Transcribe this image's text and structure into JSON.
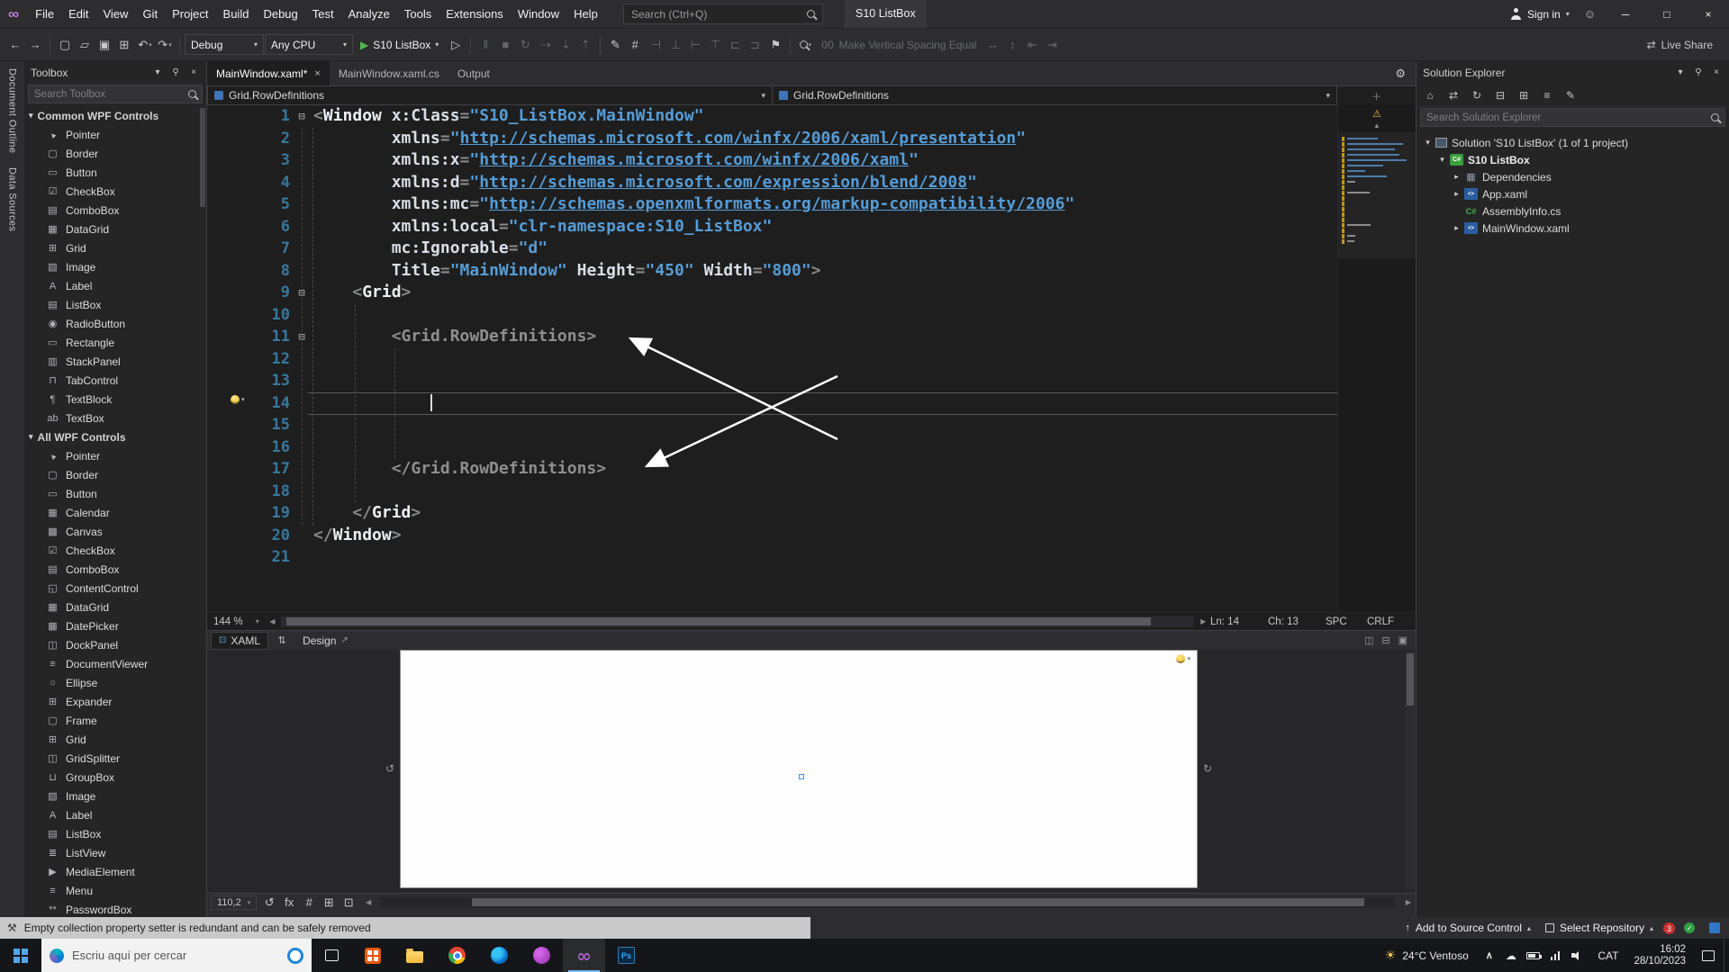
{
  "titlebar": {
    "menus": [
      "File",
      "Edit",
      "View",
      "Git",
      "Project",
      "Build",
      "Debug",
      "Test",
      "Analyze",
      "Tools",
      "Extensions",
      "Window",
      "Help"
    ],
    "search_placeholder": "Search (Ctrl+Q)",
    "window_title": "S10 ListBox",
    "sign_in": "Sign in"
  },
  "toolbar": {
    "nav_icons": [
      "back",
      "forward"
    ],
    "file_icons": [
      "new-project",
      "open-file",
      "save",
      "save-all"
    ],
    "edit_icons": [
      "undo",
      "redo"
    ],
    "debug_config": "Debug",
    "platform": "Any CPU",
    "run_label": "S10 ListBox",
    "run_icons": [
      "start-without-debugging"
    ],
    "debug_icons": [
      "break-all",
      "stop-debugging",
      "restart"
    ],
    "step_icons": [
      "show-next-statement",
      "step-into",
      "step-over"
    ],
    "design_icons": [
      "edit-style",
      "show-grid"
    ],
    "align_icons": [
      "align-lefts",
      "align-centers",
      "align-rights",
      "align-tops",
      "align-middles",
      "align-bottoms"
    ],
    "bookmark_icons": [
      "bookmark"
    ],
    "spacing_prefix": "00",
    "spacing_label": "Make Vertical Spacing Equal",
    "spacing_icons": [
      "decrease-h-spacing",
      "increase-h-spacing",
      "decrease-v-spacing",
      "increase-v-spacing"
    ],
    "live_share": "Live Share"
  },
  "left_strip": {
    "tabs": [
      "Document Outline",
      "Data Sources"
    ]
  },
  "toolbox": {
    "title": "Toolbox",
    "search_placeholder": "Search Toolbox",
    "sections": [
      {
        "label": "Common WPF Controls",
        "items": [
          "Pointer",
          "Border",
          "Button",
          "CheckBox",
          "ComboBox",
          "DataGrid",
          "Grid",
          "Image",
          "Label",
          "ListBox",
          "RadioButton",
          "Rectangle",
          "StackPanel",
          "TabControl",
          "TextBlock",
          "TextBox"
        ]
      },
      {
        "label": "All WPF Controls",
        "items": [
          "Pointer",
          "Border",
          "Button",
          "Calendar",
          "Canvas",
          "CheckBox",
          "ComboBox",
          "ContentControl",
          "DataGrid",
          "DatePicker",
          "DockPanel",
          "DocumentViewer",
          "Ellipse",
          "Expander",
          "Frame",
          "Grid",
          "GridSplitter",
          "GroupBox",
          "Image",
          "Label",
          "ListBox",
          "ListView",
          "MediaElement",
          "Menu",
          "PasswordBox"
        ]
      }
    ]
  },
  "editor": {
    "tabs": [
      {
        "label": "MainWindow.xaml*",
        "active": true
      },
      {
        "label": "MainWindow.xaml.cs",
        "active": false
      },
      {
        "label": "Output",
        "active": false
      }
    ],
    "breadcrumb_left": "Grid.RowDefinitions",
    "breadcrumb_right": "Grid.RowDefinitions",
    "zoom": "144 %",
    "status": {
      "line": "Ln: 14",
      "column": "Ch: 13",
      "spaces": "SPC",
      "line_ending": "CRLF"
    },
    "code": {
      "cursor": {
        "line": 14,
        "col": 12
      },
      "lines": [
        {
          "n": 1,
          "ind": 0,
          "fold": true,
          "seg": [
            [
              "p",
              "<"
            ],
            [
              "t",
              "Window"
            ],
            [
              "s",
              " "
            ],
            [
              "a",
              "x:Class"
            ],
            [
              "o",
              "="
            ],
            [
              "v",
              "\"S10_ListBox.MainWindow\""
            ]
          ]
        },
        {
          "n": 2,
          "ind": 8,
          "seg": [
            [
              "a",
              "xmlns"
            ],
            [
              "o",
              "="
            ],
            [
              "v",
              "\""
            ],
            [
              "u",
              "http://schemas.microsoft.com/winfx/2006/xaml/presentation"
            ],
            [
              "v",
              "\""
            ]
          ]
        },
        {
          "n": 3,
          "ind": 8,
          "seg": [
            [
              "a",
              "xmlns:x"
            ],
            [
              "o",
              "="
            ],
            [
              "v",
              "\""
            ],
            [
              "u",
              "http://schemas.microsoft.com/winfx/2006/xaml"
            ],
            [
              "v",
              "\""
            ]
          ]
        },
        {
          "n": 4,
          "ind": 8,
          "seg": [
            [
              "a",
              "xmlns:d"
            ],
            [
              "o",
              "="
            ],
            [
              "v",
              "\""
            ],
            [
              "u",
              "http://schemas.microsoft.com/expression/blend/2008"
            ],
            [
              "v",
              "\""
            ]
          ]
        },
        {
          "n": 5,
          "ind": 8,
          "seg": [
            [
              "a",
              "xmlns:mc"
            ],
            [
              "o",
              "="
            ],
            [
              "v",
              "\""
            ],
            [
              "u",
              "http://schemas.openxmlformats.org/markup-compatibility/2006"
            ],
            [
              "v",
              "\""
            ]
          ]
        },
        {
          "n": 6,
          "ind": 8,
          "seg": [
            [
              "a",
              "xmlns:local"
            ],
            [
              "o",
              "="
            ],
            [
              "v",
              "\"clr-namespace:S10_ListBox\""
            ]
          ]
        },
        {
          "n": 7,
          "ind": 8,
          "seg": [
            [
              "a",
              "mc:Ignorable"
            ],
            [
              "o",
              "="
            ],
            [
              "v",
              "\"d\""
            ]
          ]
        },
        {
          "n": 8,
          "ind": 8,
          "seg": [
            [
              "a",
              "Title"
            ],
            [
              "o",
              "="
            ],
            [
              "v",
              "\"MainWindow\""
            ],
            [
              "s",
              " "
            ],
            [
              "a",
              "Height"
            ],
            [
              "o",
              "="
            ],
            [
              "v",
              "\"450\""
            ],
            [
              "s",
              " "
            ],
            [
              "a",
              "Width"
            ],
            [
              "o",
              "="
            ],
            [
              "v",
              "\"800\""
            ],
            [
              "p",
              ">"
            ]
          ]
        },
        {
          "n": 9,
          "ind": 4,
          "fold": true,
          "seg": [
            [
              "p",
              "<"
            ],
            [
              "t",
              "Grid"
            ],
            [
              "p",
              ">"
            ]
          ]
        },
        {
          "n": 10,
          "ind": 0,
          "seg": []
        },
        {
          "n": 11,
          "ind": 8,
          "fold": true,
          "seg": [
            [
              "g",
              "<Grid.RowDefinitions>"
            ]
          ]
        },
        {
          "n": 12,
          "ind": 0,
          "seg": []
        },
        {
          "n": 13,
          "ind": 0,
          "seg": []
        },
        {
          "n": 14,
          "ind": 0,
          "seg": []
        },
        {
          "n": 15,
          "ind": 0,
          "seg": []
        },
        {
          "n": 16,
          "ind": 0,
          "seg": []
        },
        {
          "n": 17,
          "ind": 8,
          "seg": [
            [
              "g",
              "</Grid.RowDefinitions>"
            ]
          ]
        },
        {
          "n": 18,
          "ind": 0,
          "seg": []
        },
        {
          "n": 19,
          "ind": 4,
          "seg": [
            [
              "p",
              "</"
            ],
            [
              "t",
              "Grid"
            ],
            [
              "p",
              ">"
            ]
          ]
        },
        {
          "n": 20,
          "ind": 0,
          "seg": [
            [
              "p",
              "</"
            ],
            [
              "t",
              "Window"
            ],
            [
              "p",
              ">"
            ]
          ]
        },
        {
          "n": 21,
          "ind": 0,
          "seg": []
        }
      ]
    }
  },
  "designer": {
    "xaml_tab": "XAML",
    "design_tab": "Design",
    "zoom": "110,2",
    "toolbar_icons": [
      "zoom-fit",
      "effects",
      "show-grid",
      "snap-to-grid",
      "snap-to-guides"
    ]
  },
  "solution_explorer": {
    "title": "Solution Explorer",
    "search_placeholder": "Search Solution Explorer",
    "toolbar_icons": [
      "home",
      "switch-views",
      "refresh",
      "collapse-all",
      "show-all-files",
      "sync-with-active-document",
      "properties"
    ],
    "items": [
      {
        "label": "Solution 'S10 ListBox' (1 of 1 project)",
        "icon": "solution",
        "indent": 0,
        "expand": "down",
        "bold": false
      },
      {
        "label": "S10 ListBox",
        "icon": "csproj",
        "indent": 1,
        "expand": "down",
        "bold": true
      },
      {
        "label": "Dependencies",
        "icon": "dependencies",
        "indent": 2,
        "expand": "right",
        "bold": false
      },
      {
        "label": "App.xaml",
        "icon": "xaml",
        "indent": 2,
        "expand": "right",
        "bold": false
      },
      {
        "label": "AssemblyInfo.cs",
        "icon": "cs",
        "indent": 2,
        "expand": "none",
        "bold": false
      },
      {
        "label": "MainWindow.xaml",
        "icon": "xaml",
        "indent": 2,
        "expand": "right",
        "bold": false
      }
    ]
  },
  "statusbar": {
    "message": "Empty collection property setter is redundant and can be safely removed",
    "add_to_source_control": "Add to Source Control",
    "select_repository": "Select Repository",
    "notification_count": "3"
  },
  "taskbar": {
    "search_placeholder": "Escriu aquí per cercar",
    "weather": "24°C Ventoso",
    "language": "CAT",
    "time": "16:02",
    "date": "28/10/2023"
  }
}
